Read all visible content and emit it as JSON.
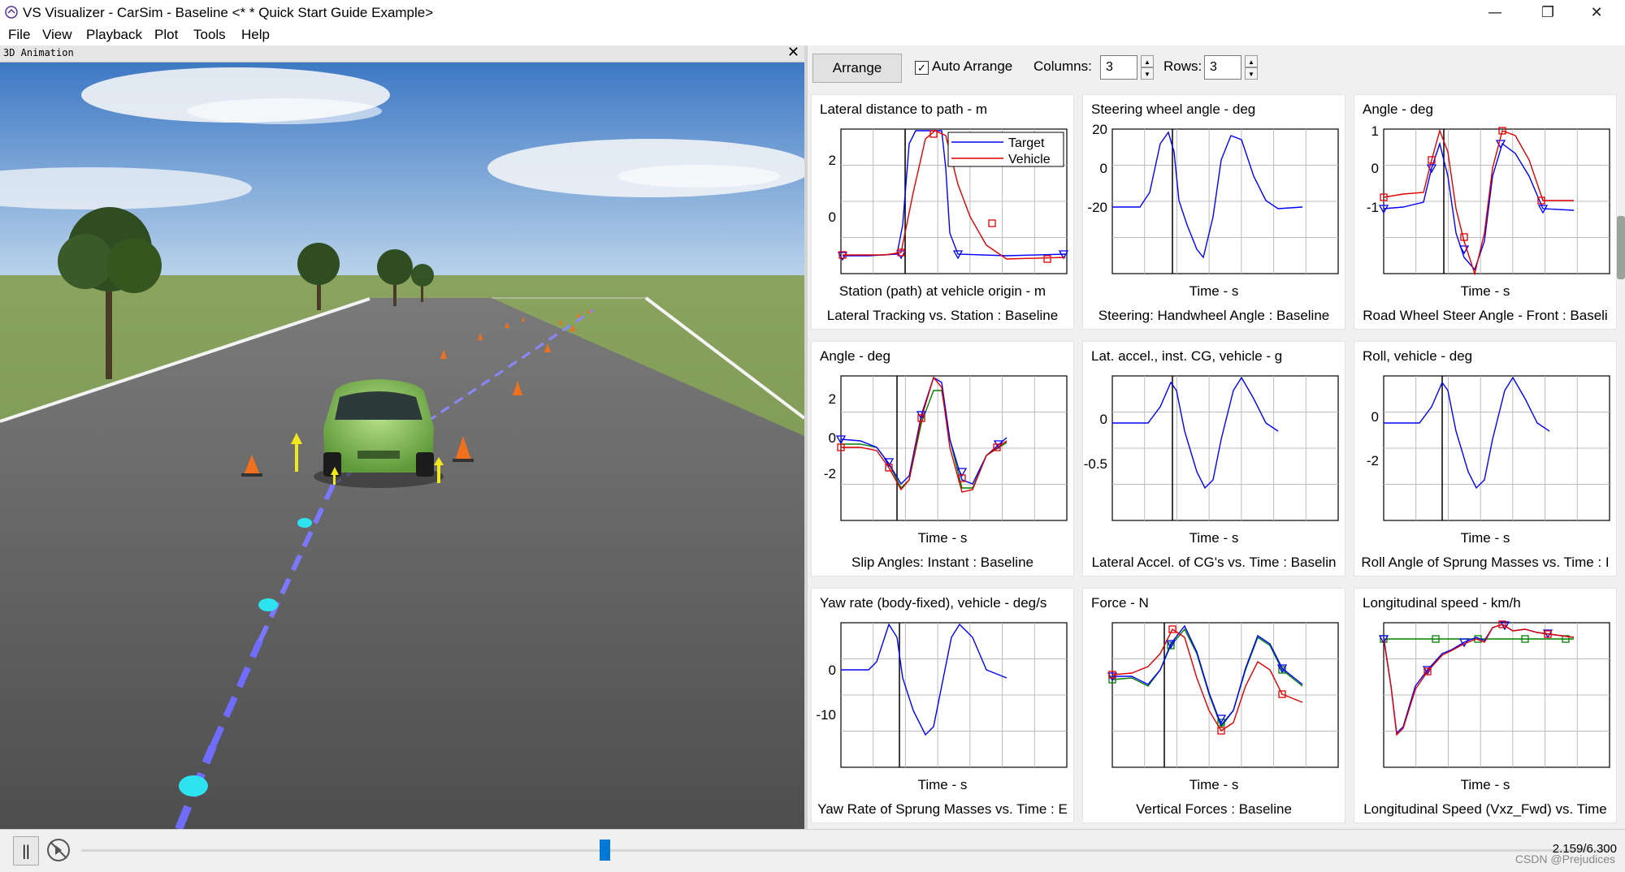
{
  "window": {
    "title": "VS Visualizer - CarSim - Baseline <* * Quick Start Guide Example>",
    "minimize_glyph": "—",
    "restore_glyph": "❐",
    "close_glyph": "✕"
  },
  "menu": {
    "items": [
      "File",
      "View",
      "Playback",
      "Plot",
      "Tools",
      "Help"
    ]
  },
  "animation": {
    "title": "3D Animation",
    "close_glyph": "✕"
  },
  "toolbar": {
    "arrange_label": "Arrange",
    "auto_arrange_checked": true,
    "auto_arrange_label": "Auto Arrange",
    "columns_label": "Columns:",
    "columns_value": "3",
    "rows_label": "Rows:",
    "rows_value": "3"
  },
  "plots": [
    {
      "title": "Lateral distance to path - m",
      "xlabel": "Station (path) at vehicle origin - m",
      "caption": "Lateral Tracking vs. Station : Baseline",
      "yticks": [
        "2",
        "0"
      ],
      "legend": [
        "Target",
        "Vehicle"
      ]
    },
    {
      "title": "Steering wheel angle - deg",
      "xlabel": "Time - s",
      "caption": "Steering: Handwheel Angle : Baseline",
      "yticks": [
        "20",
        "0",
        "-20"
      ]
    },
    {
      "title": "Angle - deg",
      "xlabel": "Time - s",
      "caption": "Road Wheel Steer Angle - Front : Baseli",
      "yticks": [
        "1",
        "0",
        "-1"
      ]
    },
    {
      "title": "Angle - deg",
      "xlabel": "Time - s",
      "caption": "Slip Angles: Instant : Baseline",
      "yticks": [
        "2",
        "0",
        "-2"
      ]
    },
    {
      "title": "Lat. accel., inst. CG, vehicle - g",
      "xlabel": "Time - s",
      "caption": "Lateral Accel. of CG's vs. Time : Baselin",
      "yticks": [
        "0",
        "-0.5"
      ]
    },
    {
      "title": "Roll, vehicle - deg",
      "xlabel": "Time - s",
      "caption": "Roll Angle of Sprung Masses vs. Time : I",
      "yticks": [
        "0",
        "-2"
      ]
    },
    {
      "title": "Yaw rate (body-fixed), vehicle - deg/s",
      "xlabel": "Time - s",
      "caption": "Yaw Rate of Sprung Masses vs. Time : E",
      "yticks": [
        "0",
        "-10"
      ]
    },
    {
      "title": "Force - N",
      "xlabel": "Time - s",
      "caption": "Vertical Forces : Baseline",
      "yticks": []
    },
    {
      "title": "Longitudinal speed - km/h",
      "xlabel": "Time - s",
      "caption": "Longitudinal Speed (Vxz_Fwd) vs. Time",
      "yticks": []
    }
  ],
  "playback": {
    "pause_glyph": "||",
    "time_readout": "2.159/6.300",
    "progress": 0.343
  },
  "watermark": "CSDN @Prejudices",
  "colors": {
    "target": "#0000ff",
    "vehicle": "#e00000",
    "green": "#008000",
    "sky_top": "#3d78c4",
    "sky_bottom": "#b9d2ea",
    "grass": "#6f8f45",
    "road": "#5a5a5a"
  }
}
